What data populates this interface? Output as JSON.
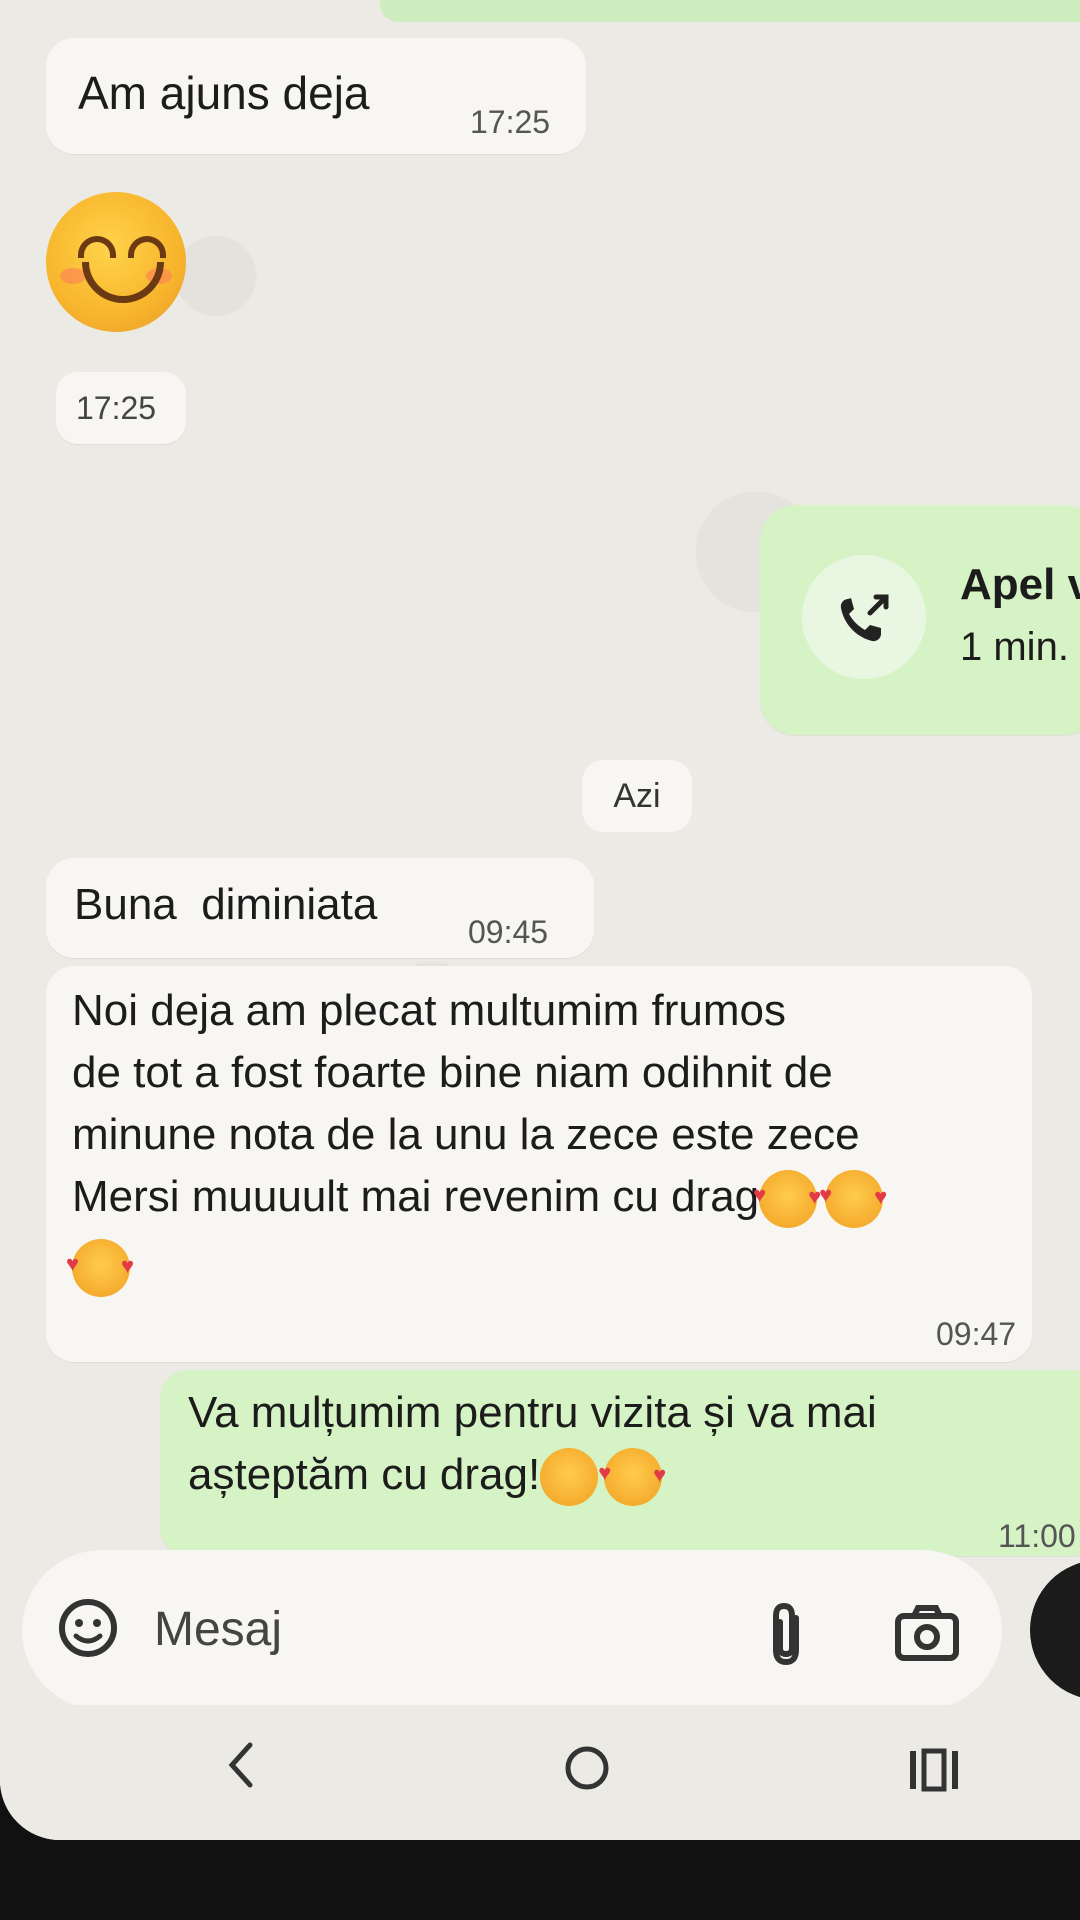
{
  "messages": [
    {
      "id": "m1",
      "direction": "in",
      "text": "Am ajuns deja",
      "time": "17:25"
    },
    {
      "id": "m2",
      "direction": "in",
      "emoji": "smiling-face-icon",
      "time": "17:25"
    },
    {
      "id": "m3",
      "direction": "out",
      "call_title": "Apel v",
      "call_duration": "1 min."
    },
    {
      "id": "m4",
      "direction": "in",
      "text": "Buna  diminiata",
      "time": "09:45"
    },
    {
      "id": "m5",
      "direction": "in",
      "lines": [
        "Noi deja am plecat multumim frumos",
        "de tot a fost foarte bine niam odihnit de",
        "minune nota de la unu la zece este zece",
        "Mersi muuuult mai revenim cu drag"
      ],
      "time": "09:47"
    },
    {
      "id": "m6",
      "direction": "out",
      "lines": [
        "Va mulțumim pentru vizita și va mai",
        "așteptăm cu drag!"
      ],
      "time": "11:00"
    }
  ],
  "date_separator": "Azi",
  "input": {
    "placeholder": "Mesaj"
  },
  "colors": {
    "incoming": "#f7f6f3",
    "outgoing": "#d5f3c4",
    "background": "#eceae4"
  }
}
